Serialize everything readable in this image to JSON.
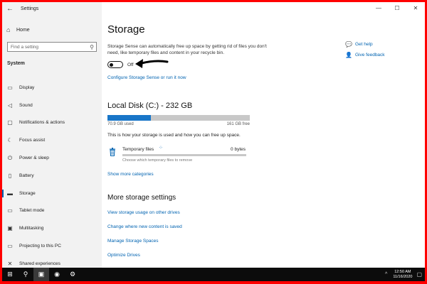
{
  "window": {
    "title": "Settings",
    "minimize": "—",
    "maximize": "☐",
    "close": "✕"
  },
  "sidebar": {
    "home": "Home",
    "search_placeholder": "Find a setting",
    "section": "System",
    "items": [
      {
        "label": "Display",
        "icon": "display-icon"
      },
      {
        "label": "Sound",
        "icon": "sound-icon"
      },
      {
        "label": "Notifications & actions",
        "icon": "notifications-icon"
      },
      {
        "label": "Focus assist",
        "icon": "focus-assist-icon"
      },
      {
        "label": "Power & sleep",
        "icon": "power-icon"
      },
      {
        "label": "Battery",
        "icon": "battery-icon"
      },
      {
        "label": "Storage",
        "icon": "storage-icon",
        "active": true
      },
      {
        "label": "Tablet mode",
        "icon": "tablet-icon"
      },
      {
        "label": "Multitasking",
        "icon": "multitasking-icon"
      },
      {
        "label": "Projecting to this PC",
        "icon": "projecting-icon"
      },
      {
        "label": "Shared experiences",
        "icon": "shared-experiences-icon"
      }
    ]
  },
  "main": {
    "title": "Storage",
    "description": "Storage Sense can automatically free up space by getting rid of files you don't need, like temporary files and content in your recycle bin.",
    "toggle_label": "Off",
    "configure_link": "Configure Storage Sense or run it now",
    "disk": {
      "title": "Local Disk (C:) - 232 GB",
      "used_label": "70.9 GB used",
      "free_label": "161 GB free",
      "used_fraction": 0.305,
      "how_to": "This is how your storage is used and how you can free up space.",
      "temp_label": "Temporary files",
      "temp_size": "0 bytes",
      "temp_sub": "Choose which temporary files to remove"
    },
    "show_more": "Show more categories",
    "more_title": "More storage settings",
    "more_links": [
      "View storage usage on other drives",
      "Change where new content is saved",
      "Manage Storage Spaces",
      "Optimize Drives"
    ]
  },
  "help": {
    "get_help": "Get help",
    "feedback": "Give feedback"
  },
  "taskbar": {
    "time": "12:50 AM",
    "date": "11/16/2020"
  },
  "colors": {
    "accent": "#0063b1",
    "frame": "#ff0000",
    "taskbar": "#0c0c0c"
  }
}
